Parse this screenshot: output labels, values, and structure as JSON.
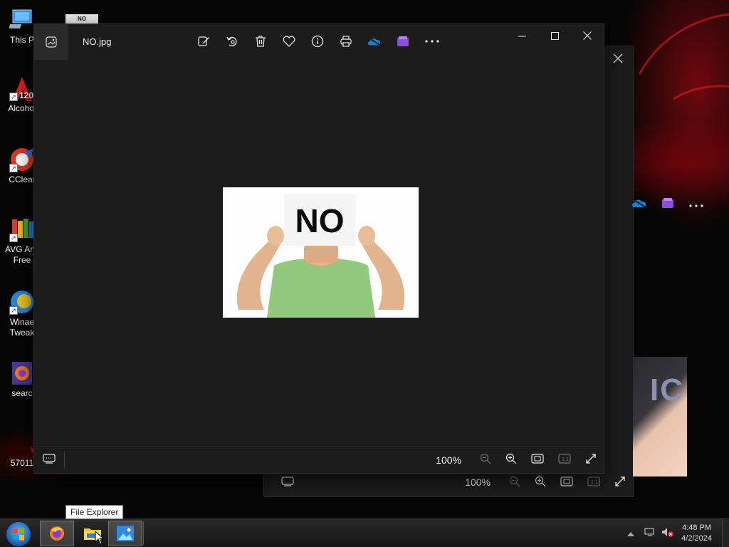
{
  "desktop": {
    "icons": [
      {
        "label": "This P",
        "icon": "computer-icon"
      },
      {
        "label": "Alcohol",
        "icon": "alcohol-120-icon"
      },
      {
        "label": "CClear",
        "icon": "ccleaner-icon"
      },
      {
        "label": "AVG Anti\nFree",
        "icon": "avg-antivirus-icon"
      },
      {
        "label": "Winae\nTweak",
        "icon": "winaero-tweaker-icon"
      },
      {
        "label": "searc",
        "icon": "firefox-search-icon"
      },
      {
        "label": "57011",
        "icon": "file-icon"
      }
    ],
    "top_file_thumb_text": "NO"
  },
  "photo_viewer": {
    "filename": "NO.jpg",
    "toolbar": [
      {
        "name": "edit-image-button",
        "icon": "edit-icon",
        "label": "Edit image"
      },
      {
        "name": "rotate-button",
        "icon": "rotate-icon",
        "label": "Rotate"
      },
      {
        "name": "delete-button",
        "icon": "trash-icon",
        "label": "Delete"
      },
      {
        "name": "favorite-button",
        "icon": "heart-icon",
        "label": "Favorite"
      },
      {
        "name": "file-info-button",
        "icon": "info-icon",
        "label": "File information"
      },
      {
        "name": "print-button",
        "icon": "printer-icon",
        "label": "Print"
      },
      {
        "name": "onedrive-button",
        "icon": "onedrive-icon",
        "label": "OneDrive"
      },
      {
        "name": "clipchamp-button",
        "icon": "clipchamp-icon",
        "label": "Clipchamp"
      },
      {
        "name": "more-button",
        "icon": "ellipsis-icon",
        "label": "See more"
      }
    ],
    "image": {
      "sign_text": "NO"
    },
    "zoom_level": "100%",
    "colors": {
      "window_bg": "#1c1c1c",
      "onedrive": "#1a7fd8",
      "clipchamp": "#8b4fe0"
    }
  },
  "background_viewer": {
    "zoom_level": "100%",
    "photo_text": "IC"
  },
  "taskbar": {
    "tooltip": "File Explorer",
    "clock_time": "4:48 PM",
    "clock_date": "4/2/2024",
    "apps": [
      "firefox-icon",
      "file-explorer-icon",
      "photos-icon"
    ]
  }
}
